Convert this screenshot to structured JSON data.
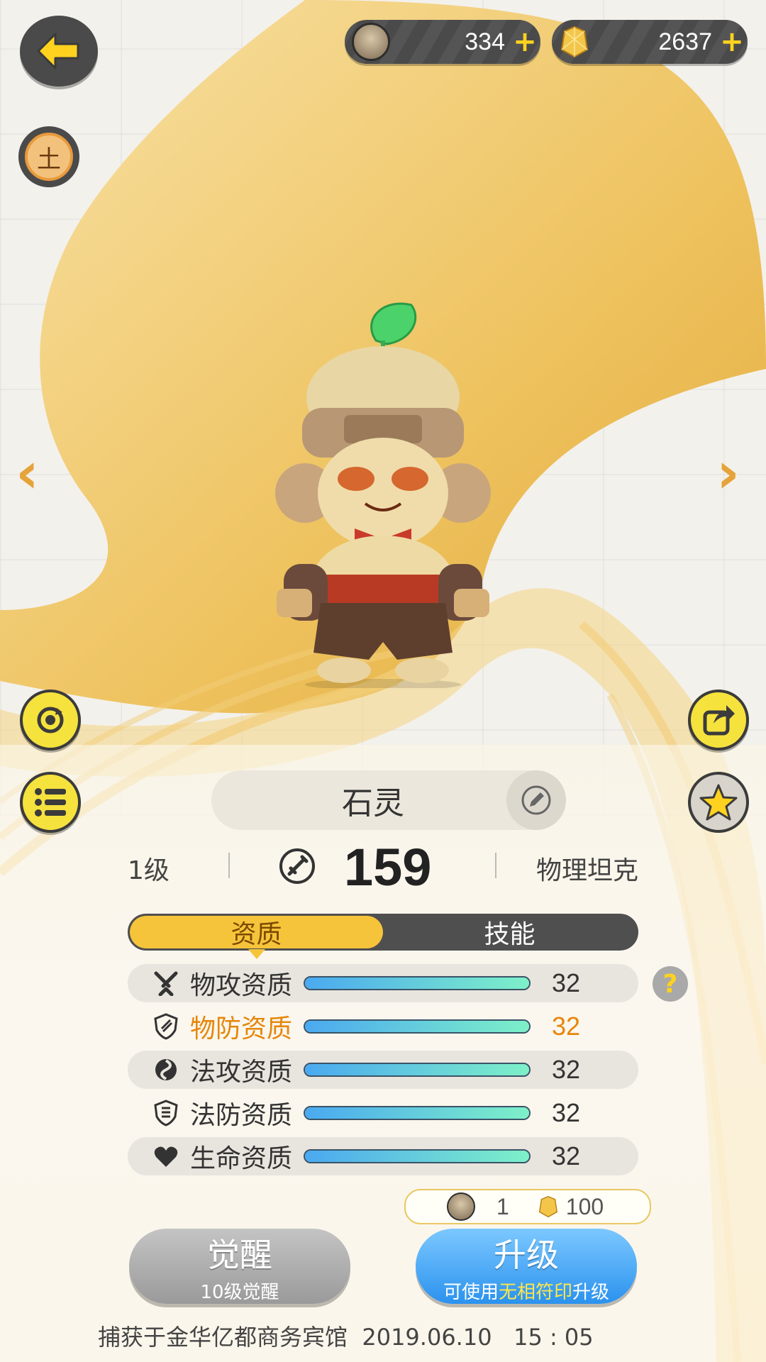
{
  "currency": {
    "coins": "334",
    "gems": "2637",
    "plus": "+"
  },
  "element_badge": "土",
  "pet": {
    "name": "石灵",
    "level": "1级",
    "power": "159",
    "role": "物理坦克"
  },
  "tabs": [
    {
      "label": "资质",
      "active": true
    },
    {
      "label": "技能",
      "active": false
    }
  ],
  "attributes": [
    {
      "icon": "swords-icon",
      "label": "物攻资质",
      "value": "32",
      "highlight": false,
      "level": 1.0
    },
    {
      "icon": "shield-icon",
      "label": "物防资质",
      "value": "32",
      "highlight": true,
      "level": 1.0
    },
    {
      "icon": "swirl-icon",
      "label": "法攻资质",
      "value": "32",
      "highlight": false,
      "level": 1.0
    },
    {
      "icon": "magic-shield-icon",
      "label": "法防资质",
      "value": "32",
      "highlight": false,
      "level": 1.0
    },
    {
      "icon": "heart-icon",
      "label": "生命资质",
      "value": "32",
      "highlight": false,
      "level": 1.0
    }
  ],
  "help": "?",
  "cost": {
    "coins": "1",
    "gems": "100"
  },
  "awaken_button": {
    "label": "觉醒",
    "sub": "10级觉醒"
  },
  "upgrade_button": {
    "label": "升级",
    "sub_prefix": "可使用",
    "sub_highlight": "无相符印",
    "sub_suffix": "升级"
  },
  "footer": "捕获于金华亿都商务宾馆  2019.06.10   15 : 05",
  "colors": {
    "accent_yellow": "#f6c43a",
    "highlight_orange": "#e6860a",
    "bar_start": "#4aa9f0",
    "bar_end": "#7ef0c8"
  }
}
